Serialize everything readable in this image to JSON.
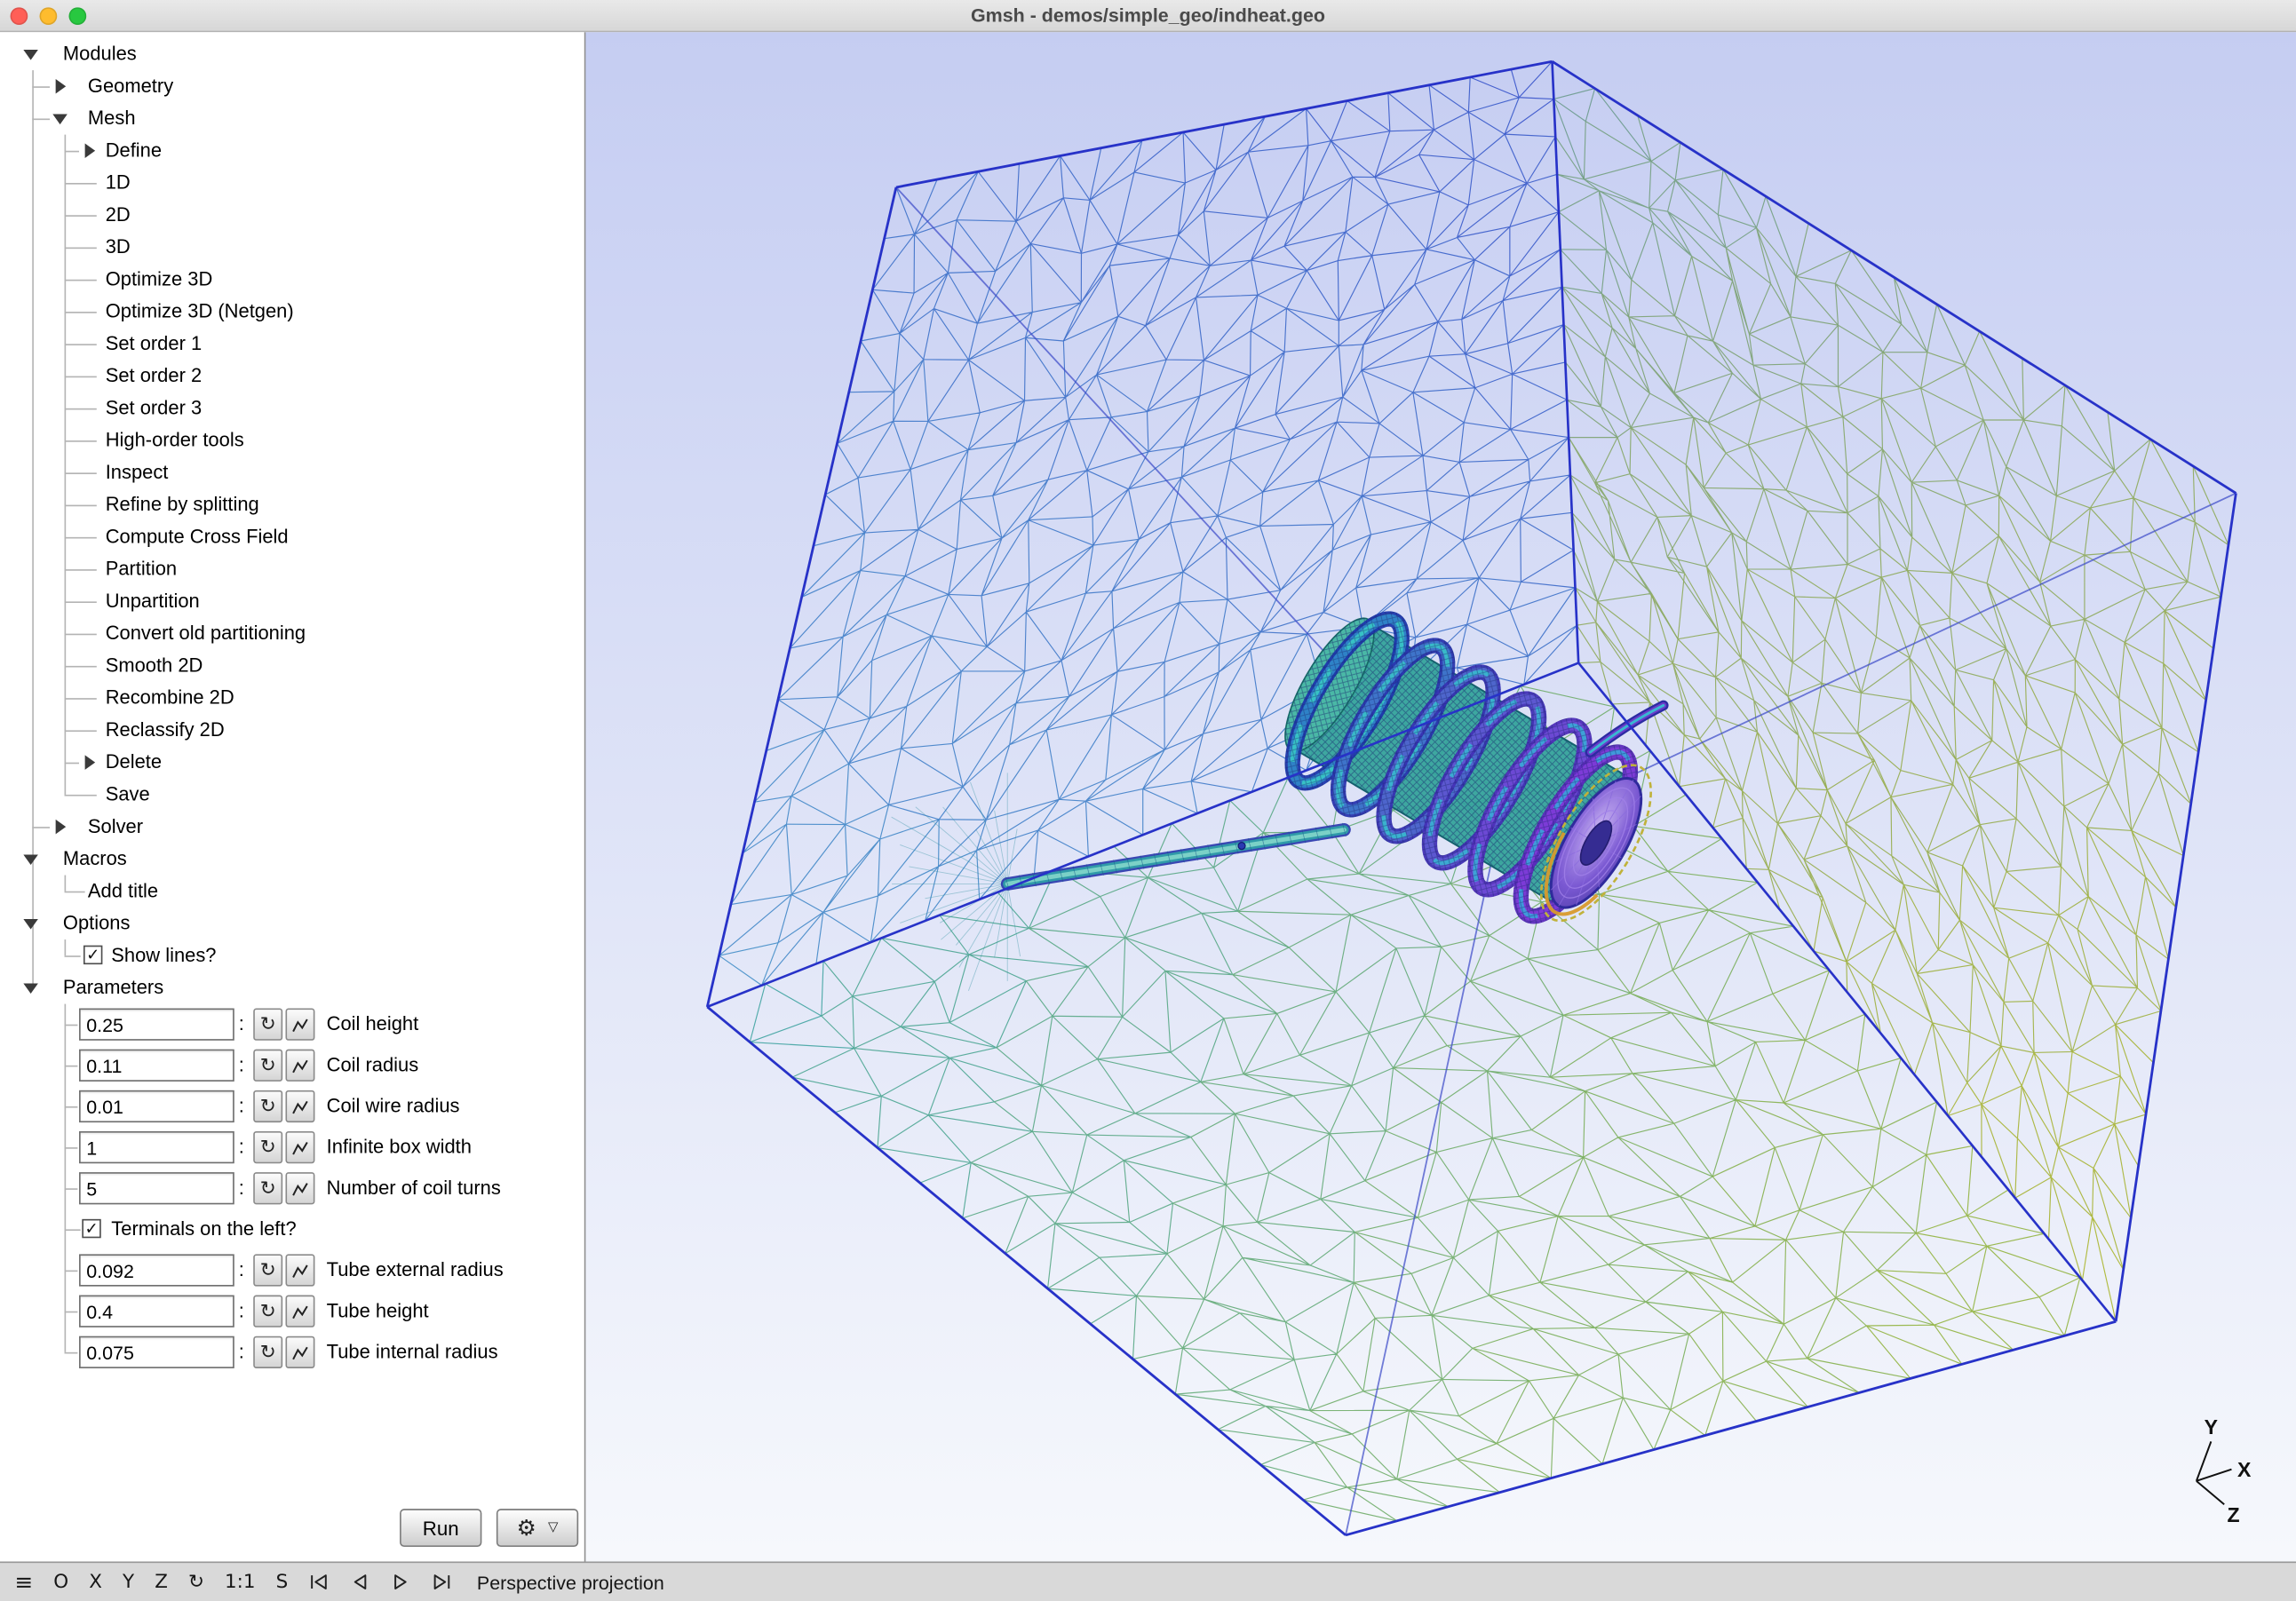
{
  "window": {
    "title": "Gmsh - demos/simple_geo/indheat.geo",
    "traffic_lights": [
      {
        "name": "close",
        "color": "#ff5f57"
      },
      {
        "name": "minimize",
        "color": "#febc2e"
      },
      {
        "name": "zoom",
        "color": "#28c840"
      }
    ]
  },
  "icons": {
    "check": "✓",
    "reload": "↻",
    "gear": "⚙",
    "dropdown": "▽"
  },
  "tree": {
    "items": [
      {
        "label": "Modules",
        "level": 0,
        "glyph": "expanded"
      },
      {
        "label": "Geometry",
        "level": 1,
        "glyph": "collapsed"
      },
      {
        "label": "Mesh",
        "level": 1,
        "glyph": "expanded"
      },
      {
        "label": "Define",
        "level": 2,
        "glyph": "collapsed"
      },
      {
        "label": "1D",
        "level": 2,
        "glyph": "leaf"
      },
      {
        "label": "2D",
        "level": 2,
        "glyph": "leaf"
      },
      {
        "label": "3D",
        "level": 2,
        "glyph": "leaf"
      },
      {
        "label": "Optimize 3D",
        "level": 2,
        "glyph": "leaf"
      },
      {
        "label": "Optimize 3D (Netgen)",
        "level": 2,
        "glyph": "leaf"
      },
      {
        "label": "Set order 1",
        "level": 2,
        "glyph": "leaf"
      },
      {
        "label": "Set order 2",
        "level": 2,
        "glyph": "leaf"
      },
      {
        "label": "Set order 3",
        "level": 2,
        "glyph": "leaf"
      },
      {
        "label": "High-order tools",
        "level": 2,
        "glyph": "leaf"
      },
      {
        "label": "Inspect",
        "level": 2,
        "glyph": "leaf"
      },
      {
        "label": "Refine by splitting",
        "level": 2,
        "glyph": "leaf"
      },
      {
        "label": "Compute Cross Field",
        "level": 2,
        "glyph": "leaf"
      },
      {
        "label": "Partition",
        "level": 2,
        "glyph": "leaf"
      },
      {
        "label": "Unpartition",
        "level": 2,
        "glyph": "leaf"
      },
      {
        "label": "Convert old partitioning",
        "level": 2,
        "glyph": "leaf"
      },
      {
        "label": "Smooth 2D",
        "level": 2,
        "glyph": "leaf"
      },
      {
        "label": "Recombine 2D",
        "level": 2,
        "glyph": "leaf"
      },
      {
        "label": "Reclassify 2D",
        "level": 2,
        "glyph": "leaf"
      },
      {
        "label": "Delete",
        "level": 2,
        "glyph": "collapsed"
      },
      {
        "label": "Save",
        "level": 2,
        "glyph": "leaf"
      },
      {
        "label": "Solver",
        "level": 1,
        "glyph": "collapsed"
      },
      {
        "label": "Macros",
        "level": 0,
        "glyph": "expanded"
      },
      {
        "label": "Add title",
        "level": 1,
        "glyph": "leaf"
      },
      {
        "label": "Options",
        "level": 0,
        "glyph": "expanded"
      },
      {
        "label": "Show lines?",
        "level": 1,
        "glyph": "checkbox",
        "checked": true
      },
      {
        "label": "Parameters",
        "level": 0,
        "glyph": "expanded"
      }
    ]
  },
  "parameters": {
    "separator": ":",
    "rows": [
      {
        "type": "input",
        "value": "0.25",
        "label": "Coil height"
      },
      {
        "type": "input",
        "value": "0.11",
        "label": "Coil radius"
      },
      {
        "type": "input",
        "value": "0.01",
        "label": "Coil wire radius"
      },
      {
        "type": "input",
        "value": "1",
        "label": "Infinite box width"
      },
      {
        "type": "input",
        "value": "5",
        "label": "Number of coil turns"
      },
      {
        "type": "checkbox",
        "label": "Terminals on the left?",
        "checked": true
      },
      {
        "type": "input",
        "value": "0.092",
        "label": "Tube external radius"
      },
      {
        "type": "input",
        "value": "0.4",
        "label": "Tube height"
      },
      {
        "type": "input",
        "value": "0.075",
        "label": "Tube internal radius"
      }
    ],
    "run_button": "Run"
  },
  "statusbar": {
    "buttons": [
      "≡",
      "O",
      "X",
      "Y",
      "Z",
      "↻",
      "1:1",
      "S"
    ],
    "playback": [
      "rewind",
      "step-back",
      "play",
      "step-forward"
    ],
    "projection_label": "Perspective projection"
  },
  "viewport": {
    "axes": {
      "x": "X",
      "y": "Y",
      "z": "Z"
    },
    "colors": {
      "background_top": "#c5cdf2",
      "background_bottom": "#f6f8fc",
      "cube_edge": "#2732c8",
      "hidden_edge": "#3a49c8",
      "mesh_blue_a": "#3350c8",
      "mesh_blue_b": "#3f8cc6",
      "mesh_green": "#a9b428",
      "mesh_teal": "#2f9fae",
      "tube_teal": "#35a39b",
      "coil_blue": "#1e38ac",
      "coil_purple": "#5c2cbc",
      "coil_cyan": "#38c8c4",
      "cap_purple": "#7a58d2",
      "cap_rim_yellow": "#d89a2c"
    }
  }
}
